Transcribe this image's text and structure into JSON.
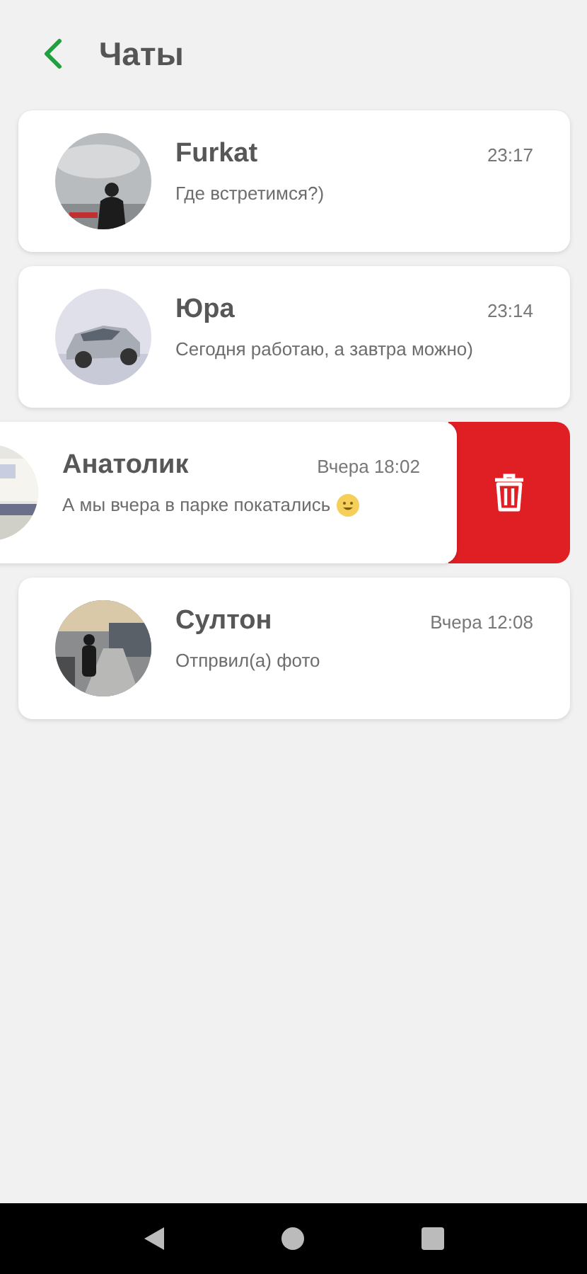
{
  "header": {
    "title": "Чаты"
  },
  "chats": [
    {
      "name": "Furkat",
      "time": "23:17",
      "message": "Где встретимся?)",
      "swiped": false,
      "smiley": false
    },
    {
      "name": "Юра",
      "time": "23:14",
      "message": "Сегодня работаю, а завтра можно)",
      "swiped": false,
      "smiley": false
    },
    {
      "name": "Анатолик",
      "time": "Вчера 18:02",
      "message": "А мы вчера в парке покатались",
      "swiped": true,
      "smiley": true
    },
    {
      "name": "Султон",
      "time": "Вчера 12:08",
      "message": "Отпрвил(а) фото",
      "swiped": false,
      "smiley": false
    }
  ]
}
